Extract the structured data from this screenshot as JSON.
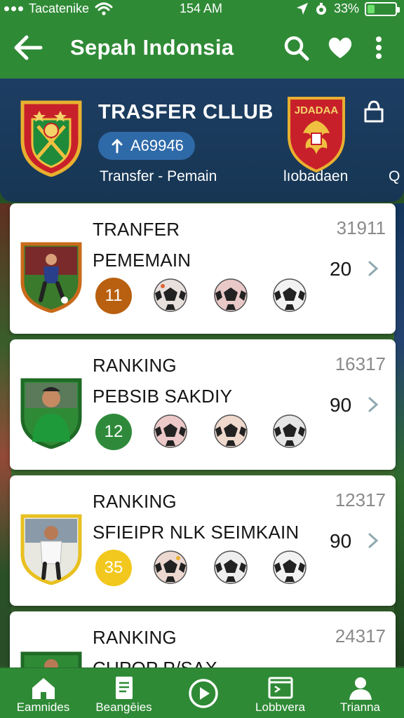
{
  "status_bar": {
    "carrier": "Tacatenike",
    "time": "154 AM",
    "battery": "33%",
    "battery_level": 0.33
  },
  "app_bar": {
    "title": "Sepah Indonsia"
  },
  "header": {
    "title": "TRASFER CLLUB",
    "pill_value": "A6994̈6",
    "subtitle": "Transfer - Pemain",
    "club2_label": "lıobadaen",
    "club2_crest_text": "JDADAA",
    "peek_label": "Q"
  },
  "cards": [
    {
      "title": "TRANFER",
      "subtitle": "PEMEMAIN",
      "count": "31911",
      "score": "20",
      "badge": "11",
      "badge_color": "#b8600f"
    },
    {
      "title": "RANKING",
      "subtitle": "PEBSIB SAKDIY",
      "count": "16317",
      "score": "90",
      "badge": "12",
      "badge_color": "#2e8a3a"
    },
    {
      "title": "RANKING",
      "subtitle": "SFIEIPR NLK SEIMKAIN",
      "count": "12317",
      "score": "90",
      "badge": "35",
      "badge_color": "#f2c81e"
    },
    {
      "title": "RANKING",
      "subtitle": "CUPOP P/SAX",
      "count": "24317"
    }
  ],
  "bottom_nav": [
    {
      "label": "Eamnides",
      "icon": "home-icon"
    },
    {
      "label": "Beangēies",
      "icon": "document-icon"
    },
    {
      "label": "",
      "icon": "play-circle-icon"
    },
    {
      "label": "Lobbvera",
      "icon": "folder-icon"
    },
    {
      "label": "Trianna",
      "icon": "person-icon"
    }
  ],
  "colors": {
    "primary_green": "#2f8a36",
    "banner_navy": "#1d3e63",
    "pill_blue": "#2f6aa8"
  }
}
